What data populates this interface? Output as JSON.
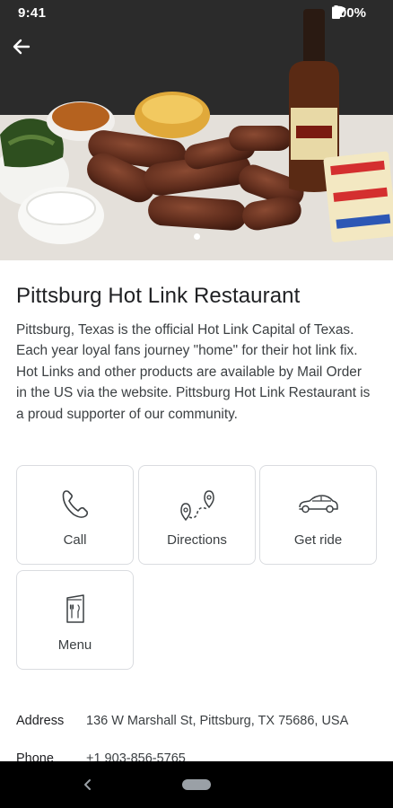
{
  "status_bar": {
    "time": "9:41",
    "battery": "100%"
  },
  "hero": {
    "image": "Hot links with sides and sauce photo",
    "page_indicator": {
      "count": 1,
      "active": 1
    }
  },
  "place": {
    "name": "Pittsburg Hot Link Restaurant",
    "description": "Pittsburg, Texas is the official Hot Link Capital of Texas. Each year loyal fans journey \"home\" for their hot link fix. Hot Links and other products are available by Mail Order in the US via the website. Pittsburg Hot Link Restaurant is a proud supporter of our community."
  },
  "actions": [
    {
      "label": "Call",
      "icon": "phone-icon"
    },
    {
      "label": "Directions",
      "icon": "route-icon"
    },
    {
      "label": "Get ride",
      "icon": "car-icon"
    },
    {
      "label": "Menu",
      "icon": "menu-icon"
    }
  ],
  "details": [
    {
      "key": "Address",
      "value": "136 W Marshall St, Pittsburg, TX 75686, USA"
    },
    {
      "key": "Phone",
      "value": "+1 903-856-5765"
    }
  ],
  "colors": {
    "card_border": "#dadce0",
    "text_primary": "#202124",
    "text_secondary": "#3c4043",
    "nav_bar": "#000000"
  }
}
